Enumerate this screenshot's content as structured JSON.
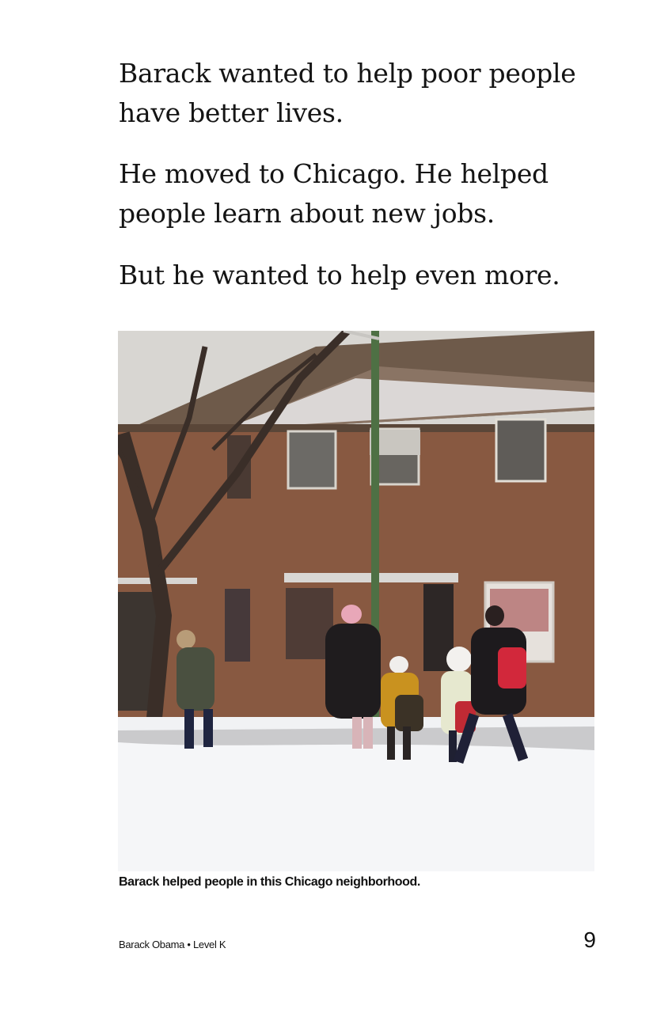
{
  "paragraphs": [
    "Barack wanted to help poor people have better lives.",
    "He moved to Chicago. He helped people learn about new jobs.",
    "But he wanted to help even more."
  ],
  "figure": {
    "caption": "Barack helped people in this Chicago neighborhood."
  },
  "footer": {
    "book_title": "Barack Obama • Level K",
    "page_number": "9"
  }
}
